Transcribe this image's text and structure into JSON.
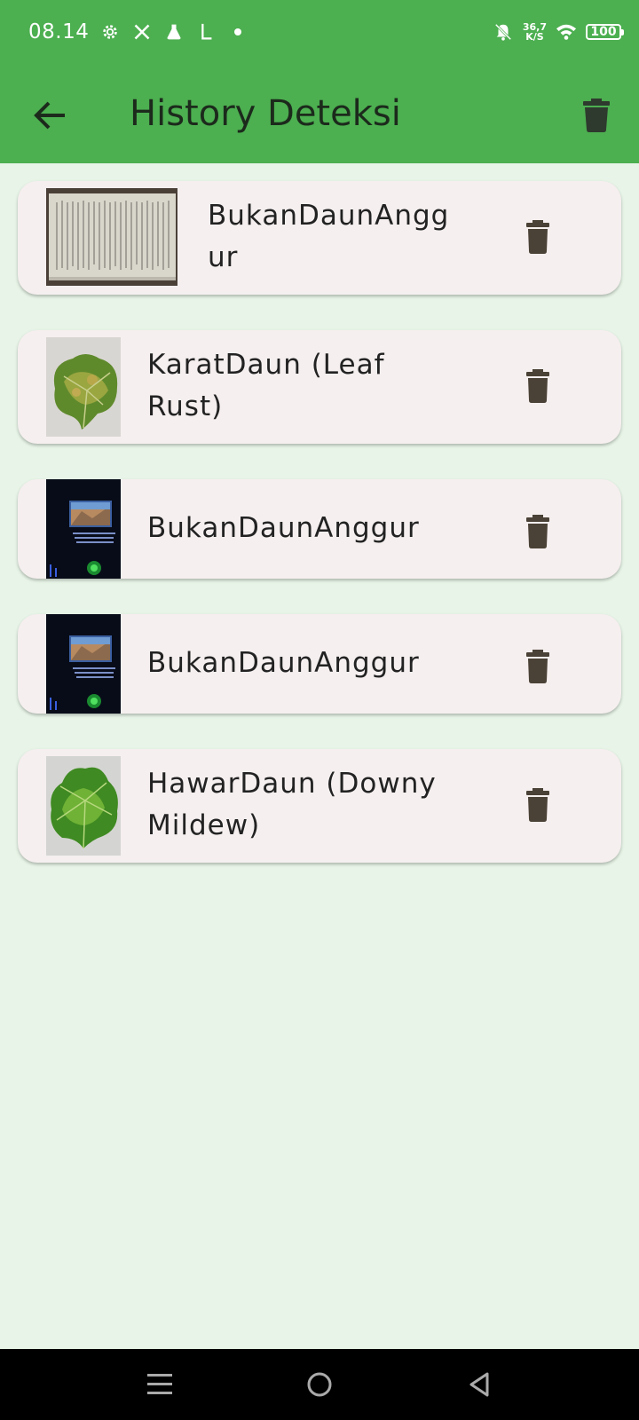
{
  "status_bar": {
    "time": "08.14",
    "speed_value": "36,7",
    "speed_unit": "K/S",
    "battery": "100",
    "icons": [
      "gear-icon",
      "x-logo-icon",
      "flask-icon",
      "l-icon",
      "dot-icon",
      "bell-off-icon",
      "wifi-icon",
      "battery-icon"
    ]
  },
  "app_bar": {
    "title": "History Deteksi",
    "back_icon": "arrow-left-icon",
    "delete_icon": "trash-icon",
    "background": "#4caf50"
  },
  "history": [
    {
      "label_lines": [
        "BukanDaunAngg",
        "ur"
      ],
      "thumbnail": "document-photo"
    },
    {
      "label_lines": [
        "KaratDaun (Leaf",
        "Rust)"
      ],
      "thumbnail": "leaf-rust-photo"
    },
    {
      "label_lines": [
        "BukanDaunAnggur"
      ],
      "thumbnail": "laptop-photo"
    },
    {
      "label_lines": [
        "BukanDaunAnggur"
      ],
      "thumbnail": "laptop-photo"
    },
    {
      "label_lines": [
        "HawarDaun (Downy",
        "Mildew)"
      ],
      "thumbnail": "leaf-mildew-photo"
    }
  ],
  "nav_bar": {
    "icons": [
      "menu-icon",
      "home-icon",
      "back-triangle-icon"
    ]
  }
}
